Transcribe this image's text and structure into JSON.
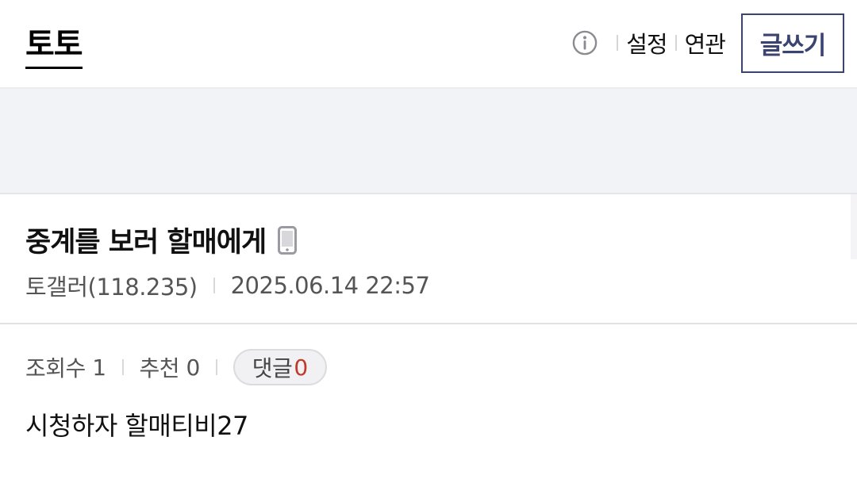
{
  "header": {
    "gallery_title": "토토",
    "info_icon": "info-circle-icon",
    "settings_label": "설정",
    "related_label": "연관",
    "write_label": "글쓰기"
  },
  "post": {
    "title": "중계를 보러 할매에게",
    "mobile_icon": "mobile-phone-icon",
    "author": "토갤러(118.235)",
    "datetime": "2025.06.14 22:57",
    "views_label": "조회수",
    "views": "1",
    "recommend_label": "추천",
    "recommend": "0",
    "comments_label": "댓글",
    "comments": "0",
    "body": "시청하자 할매티비27"
  },
  "colors": {
    "accent": "#3b4470",
    "comment_count": "#c0392b",
    "banner_bg": "#f2f3f7"
  }
}
